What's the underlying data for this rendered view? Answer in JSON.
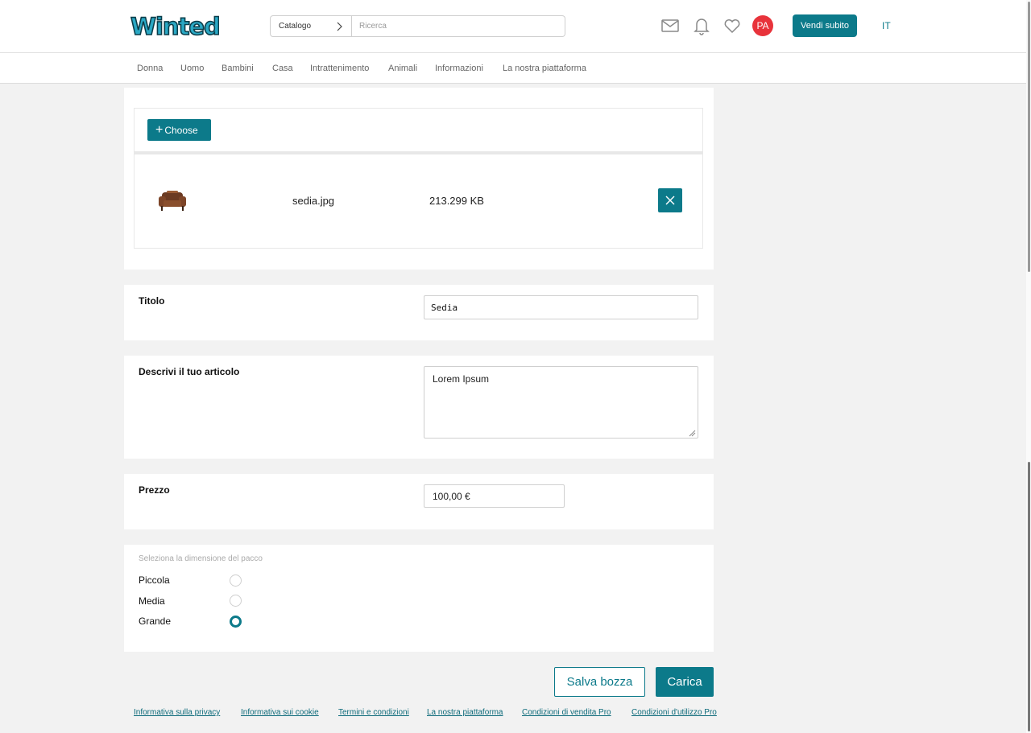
{
  "header": {
    "logo_text": "Winted",
    "catalog_label": "Catalogo",
    "search_placeholder": "Ricerca",
    "avatar_initials": "PA",
    "sell_label": "Vendi subito",
    "language": "IT",
    "icons": [
      "mail-icon",
      "bell-icon",
      "heart-icon"
    ],
    "accent_color": "#0c7a8a",
    "avatar_color": "#e8333b"
  },
  "nav": {
    "items": [
      "Donna",
      "Uomo",
      "Bambini",
      "Casa",
      "Intrattenimento",
      "Animali",
      "Informazioni",
      "La nostra piattaforma"
    ]
  },
  "upload": {
    "choose_label": "Choose",
    "file": {
      "name": "sedia.jpg",
      "size": "213.299 KB",
      "thumbnail": "armchair-thumbnail"
    }
  },
  "form": {
    "title_label": "Titolo",
    "title_value": "Sedia",
    "description_label": "Descrivi il tuo articolo",
    "description_value": "Lorem Ipsum",
    "price_label": "Prezzo",
    "price_value": "100,00 €"
  },
  "package": {
    "legend": "Seleziona la dimensione del pacco",
    "options": [
      "Piccola",
      "Media",
      "Grande"
    ],
    "selected": "Grande"
  },
  "actions": {
    "save_draft": "Salva bozza",
    "upload": "Carica"
  },
  "footer": {
    "links": [
      "Informativa sulla privacy",
      "Informativa sui cookie",
      "Termini e condizioni",
      "La nostra piattaforma",
      "Condizioni di vendita Pro",
      "Condizioni d'utilizzo Pro"
    ]
  }
}
